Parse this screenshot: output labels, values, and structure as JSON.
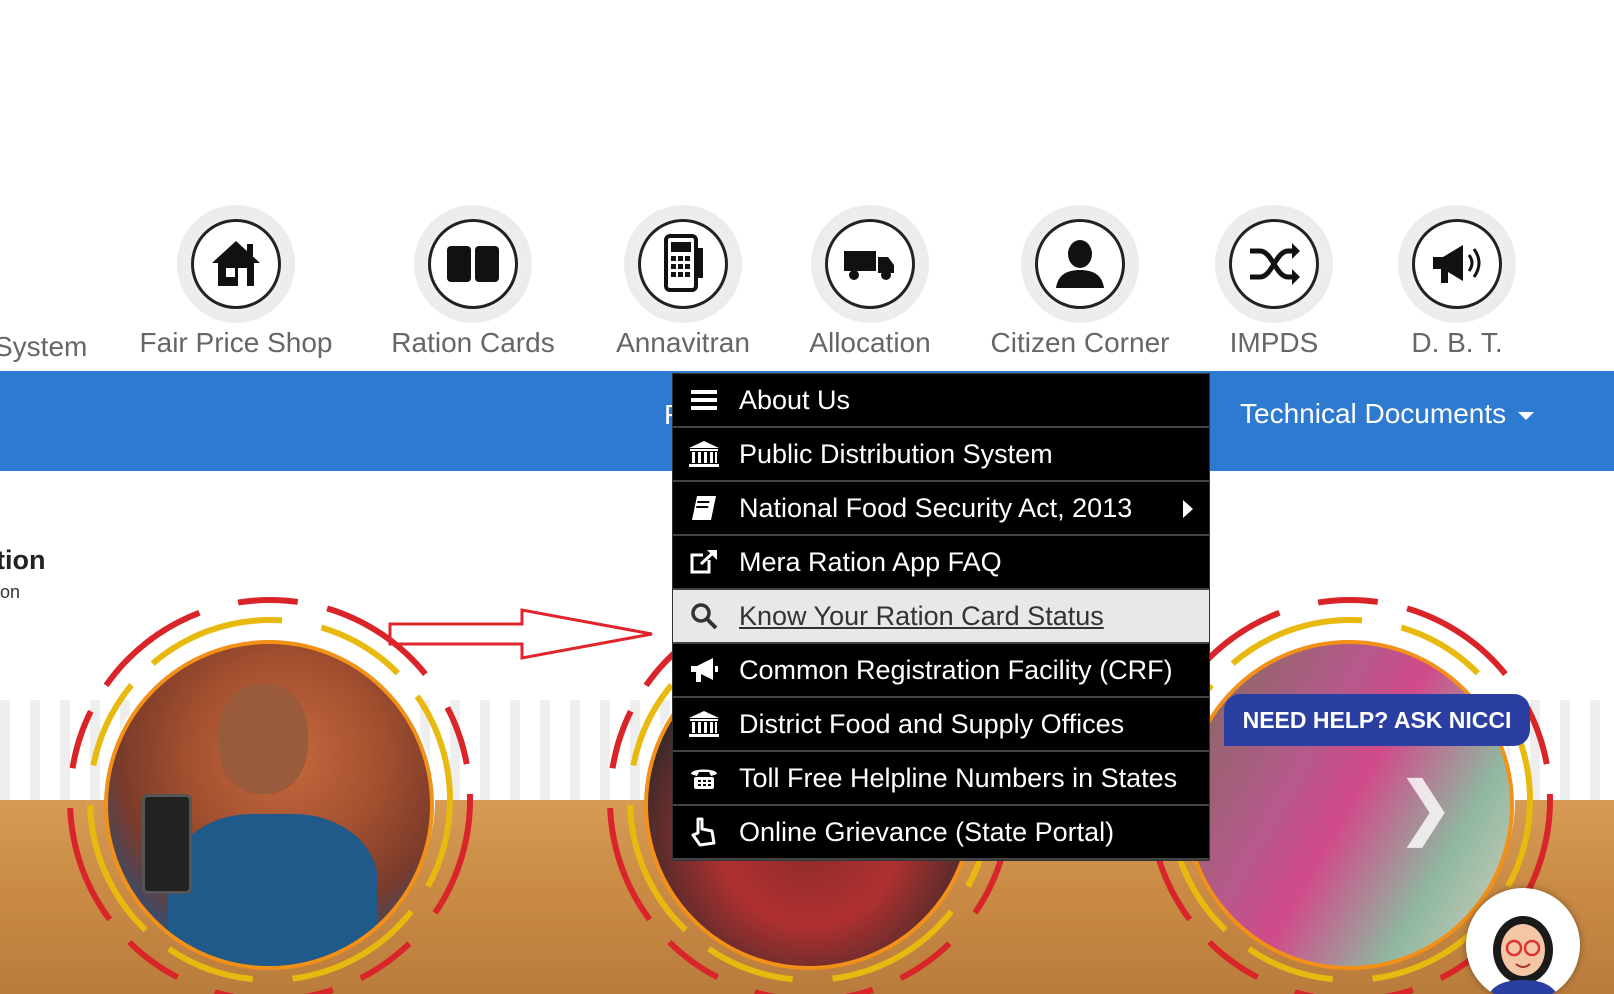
{
  "icon_nav": {
    "partial_item": "System",
    "items": [
      {
        "label": "Fair Price Shop",
        "icon": "home-icon"
      },
      {
        "label": "Ration Cards",
        "icon": "book-icon"
      },
      {
        "label": "Annavitran",
        "icon": "pos-machine-icon"
      },
      {
        "label": "Allocation",
        "icon": "truck-icon"
      },
      {
        "label": "Citizen Corner",
        "icon": "user-icon"
      },
      {
        "label": "IMPDS",
        "icon": "shuffle-icon"
      },
      {
        "label": "D. B. T.",
        "icon": "megaphone-icon"
      }
    ]
  },
  "blue_bar": {
    "hidden_fragment": "F",
    "technical_documents": "Technical Documents"
  },
  "left_fragment": {
    "title": "tion",
    "subtitle": "on"
  },
  "dropdown": {
    "items": [
      {
        "label": "About Us",
        "icon": "menu-icon",
        "active": false,
        "submenu": false
      },
      {
        "label": "Public Distribution System",
        "icon": "bank-icon",
        "active": false,
        "submenu": false
      },
      {
        "label": "National Food Security Act, 2013",
        "icon": "book-icon",
        "active": false,
        "submenu": true
      },
      {
        "label": "Mera Ration App FAQ",
        "icon": "external-link-icon",
        "active": false,
        "submenu": false
      },
      {
        "label": "Know Your Ration Card Status",
        "icon": "search-icon",
        "active": true,
        "submenu": false
      },
      {
        "label": "Common Registration Facility (CRF)",
        "icon": "bullhorn-icon",
        "active": false,
        "submenu": false
      },
      {
        "label": "District Food and Supply Offices",
        "icon": "bank-icon",
        "active": false,
        "submenu": false
      },
      {
        "label": "Toll Free Helpline Numbers in States",
        "icon": "phone-icon",
        "active": false,
        "submenu": false
      },
      {
        "label": "Online Grievance (State Portal)",
        "icon": "hand-pointer-icon",
        "active": false,
        "submenu": false
      }
    ]
  },
  "help": {
    "label": "NEED HELP? ASK NICCI"
  },
  "colors": {
    "nav_bar": "#2e7ad1",
    "dropdown_bg": "#000000",
    "active_item_bg": "#e8e8ea",
    "help_badge": "#2a3fa1",
    "annotation_arrow": "#e0242b",
    "ring_red": "#d9252a",
    "ring_yellow": "#e8b90f",
    "ring_orange": "#f29018"
  }
}
